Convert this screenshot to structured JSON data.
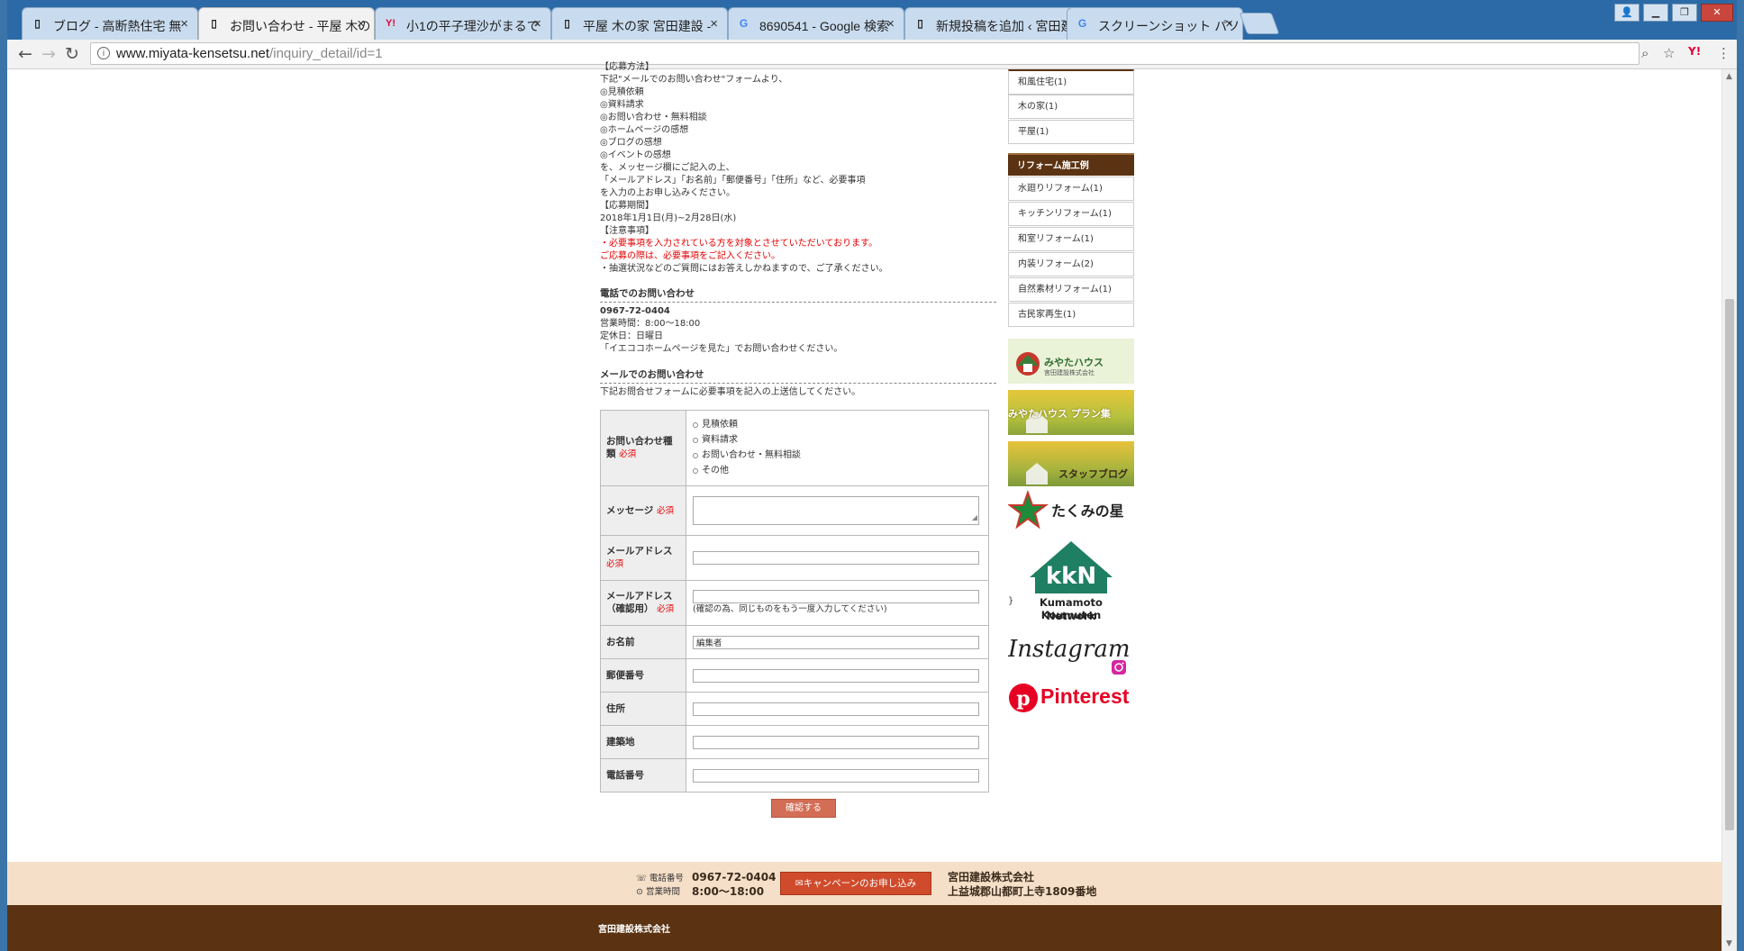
{
  "browser": {
    "tabs": [
      {
        "title": "ブログ - 高断熱住宅 無",
        "icon": "page-icon"
      },
      {
        "title": "お問い合わせ - 平屋 木の",
        "icon": "page-icon",
        "active": true
      },
      {
        "title": "小1の平子理沙がまるで",
        "icon": "yahoo-icon"
      },
      {
        "title": "平屋 木の家 宮田建設 -",
        "icon": "page-icon"
      },
      {
        "title": "8690541 - Google 検索",
        "icon": "google-icon"
      },
      {
        "title": "新規投稿を追加 ‹ 宮田建",
        "icon": "page-icon"
      },
      {
        "title": "スクリーンショット パソ",
        "icon": "google-icon"
      }
    ],
    "url_host": "www.miyata-kensetsu.net",
    "url_path": "/inquiry_detail/id=1"
  },
  "content": {
    "intro_lines": [
      "【応募方法】",
      "下記\"メールでのお問い合わせ\"フォームより、",
      "◎見積依頼",
      "◎資料請求",
      "◎お問い合わせ・無料相談",
      "◎ホームページの感想",
      "◎ブログの感想",
      "◎イベントの感想",
      "を、メッセージ欄にご記入の上、",
      "「メールアドレス」「お名前」「郵便番号」「住所」など、必要事項",
      "を入力の上お申し込みください。",
      "【応募期間】",
      "2018年1月1日(月)~2月28日(水)",
      "【注意事項】"
    ],
    "notice_red_1": "・必要事項を入力されている方を対象とさせていただいております。",
    "notice_red_2": "ご応募の際は、必要事項をご記入ください。",
    "notice_black": "・抽選状況などのご質問にはお答えしかねますので、ご了承ください。",
    "phone_section_title": "電話でのお問い合わせ",
    "phone_number": "0967-72-0404",
    "phone_hours": "営業時間：8:00～18:00",
    "phone_holiday": "定休日：日曜日",
    "phone_note": "「イエココホームページを見た」でお問い合わせください。",
    "mail_section_title": "メールでのお問い合わせ",
    "mail_note": "下記お問合せフォームに必要事項を記入の上送信してください。",
    "required_mark": "必須",
    "form": {
      "type_label": "お問い合わせ種類",
      "type_options": [
        "見積依頼",
        "資料請求",
        "お問い合わせ・無料相談",
        "その他"
      ],
      "message_label": "メッセージ",
      "email_label": "メールアドレス",
      "email_confirm_label": "メールアドレス（確認用）",
      "email_confirm_hint": "(確認の為、同じものをもう一度入力してください)",
      "name_label": "お名前",
      "name_value": "編集者",
      "zip_label": "郵便番号",
      "address_label": "住所",
      "site_label": "建築地",
      "tel_label": "電話番号",
      "confirm_button": "確認する"
    }
  },
  "sidebar": {
    "top_items": [
      "和風住宅(1)",
      "木の家(1)",
      "平屋(1)"
    ],
    "reform_heading": "リフォーム施工例",
    "reform_items": [
      "水廻りリフォーム(1)",
      "キッチンリフォーム(1)",
      "和室リフォーム(1)",
      "内装リフォーム(2)",
      "自然素材リフォーム(1)",
      "古民家再生(1)"
    ],
    "banner_miyata_house": "みやたハウス",
    "banner_miyata_house_sub": "宮田建設株式会社",
    "banner_plan": "みやたハウス プラン集",
    "banner_staff_blog": "スタッフブログ",
    "banner_kumamoto_star": "たくみの星",
    "kkn_letters": "kkN",
    "kkn_line1": "Kumamoto Koumuten",
    "kkn_line2": "Network",
    "instagram": "Instagram",
    "pinterest": "Pinterest"
  },
  "footer": {
    "phone_label": "電話番号",
    "phone_value": "0967-72-0404",
    "hours_label": "営業時間",
    "hours_value": "8:00～18:00",
    "campaign_button": "キャンペーンのお申し込み",
    "company": "宮田建設株式会社",
    "address": "上益城郡山都町上寺1809番地",
    "copyright_company": "宮田建設株式会社"
  }
}
